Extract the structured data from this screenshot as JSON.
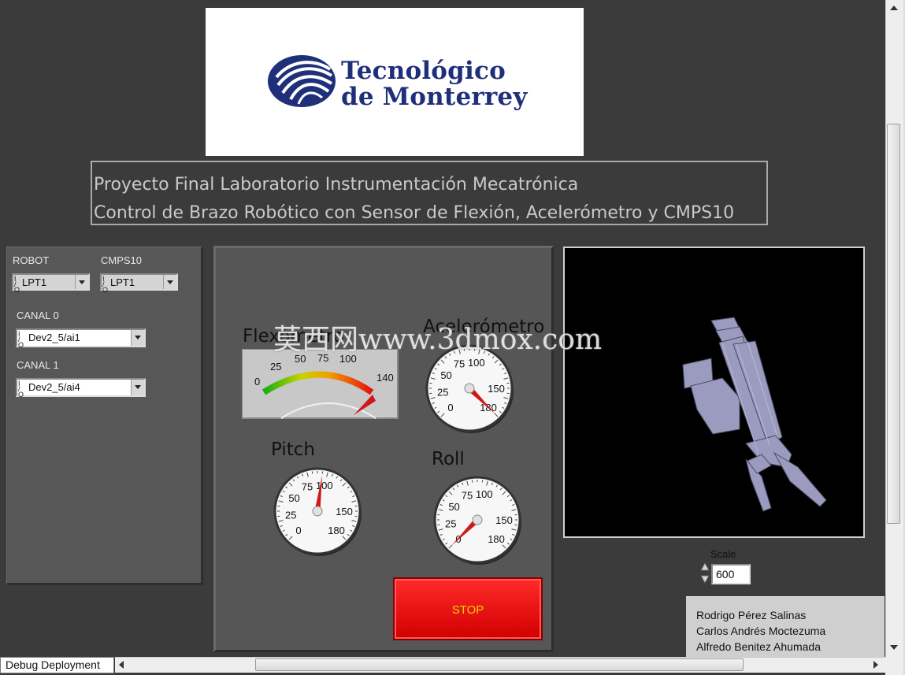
{
  "logo": {
    "line1": "Tecnológico",
    "line2": "de Monterrey"
  },
  "title": {
    "line1": "Proyecto Final Laboratorio Instrumentación Mecatrónica",
    "line2": "Control de Brazo Robótico con Sensor de Flexión, Acelerómetro y CMPS10"
  },
  "config": {
    "robot_label": "ROBOT",
    "robot_value": "LPT1",
    "cmps_label": "CMPS10",
    "cmps_value": "LPT1",
    "canal0_label": "CANAL 0",
    "canal0_value": "Dev2_5/ai1",
    "canal1_label": "CANAL 1",
    "canal1_value": "Dev2_5/ai4",
    "io_glyph": "I/O"
  },
  "gauges": {
    "flex": {
      "title": "Flexómetro",
      "ticks": [
        "0",
        "25",
        "50",
        "75",
        "100",
        "140"
      ],
      "value": 140,
      "max": 140
    },
    "accel": {
      "title": "Acelerómetro",
      "ticks": [
        "0",
        "25",
        "50",
        "75",
        "100",
        "150",
        "180"
      ],
      "value": 180,
      "max": 180
    },
    "pitch": {
      "title": "Pitch",
      "ticks": [
        "0",
        "25",
        "50",
        "75",
        "100",
        "150",
        "180"
      ],
      "value": 95,
      "max": 180
    },
    "roll": {
      "title": "Roll",
      "ticks": [
        "0",
        "25",
        "50",
        "75",
        "100",
        "150",
        "180"
      ],
      "value": 0,
      "max": 180
    }
  },
  "stop": {
    "label": "STOP"
  },
  "scale": {
    "label": "Scale",
    "value": "600"
  },
  "credits": [
    "Rodrigo Pérez Salinas",
    "Carlos Andrés Moctezuma",
    "Alfredo Benitez Ahumada"
  ],
  "status": {
    "label": "Debug Deployment"
  },
  "watermark": "莫西网www.3dmox.com",
  "colors": {
    "stop_red": "#e81010",
    "stop_text": "#f0d000",
    "needle": "#d01818",
    "logo_blue": "#1f2f7a"
  }
}
